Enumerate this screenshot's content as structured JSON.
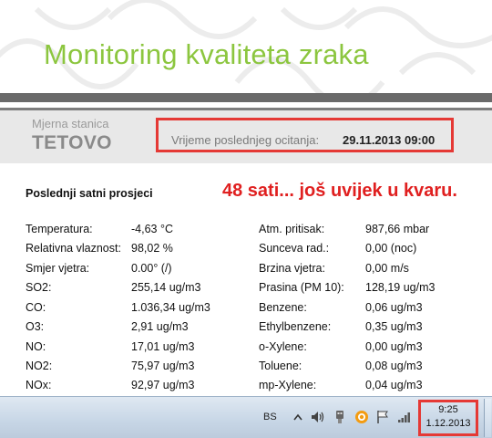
{
  "header": {
    "title": "Monitoring kvaliteta zraka"
  },
  "station": {
    "label": "Mjerna stanica",
    "name": "TETOVO",
    "reading_label": "Vrijeme poslednjeg ocitanja:",
    "reading_value": "29.11.2013 09:00"
  },
  "main": {
    "section_title": "Poslednji satni prosjeci",
    "alert": "48 sati... još uvijek u kvaru.",
    "left_measurements": [
      {
        "label": "Temperatura:",
        "value": "-4,63 °C"
      },
      {
        "label": "Relativna vlaznost:",
        "value": "98,02 %"
      },
      {
        "label": "Smjer vjetra:",
        "value": "0.00° (/)"
      },
      {
        "label": "SO2:",
        "value": "255,14 ug/m3"
      },
      {
        "label": "CO:",
        "value": "1.036,34 ug/m3"
      },
      {
        "label": "O3:",
        "value": "2,91 ug/m3"
      },
      {
        "label": "NO:",
        "value": "17,01 ug/m3"
      },
      {
        "label": "NO2:",
        "value": "75,97 ug/m3"
      },
      {
        "label": "NOx:",
        "value": "92,97 ug/m3"
      }
    ],
    "right_measurements": [
      {
        "label": "Atm. pritisak:",
        "value": "987,66 mbar"
      },
      {
        "label": "Sunceva rad.:",
        "value": "0,00 (noc)"
      },
      {
        "label": "Brzina vjetra:",
        "value": "0,00 m/s"
      },
      {
        "label": "Prasina (PM 10):",
        "value": "128,19 ug/m3"
      },
      {
        "label": "Benzene:",
        "value": "0,06 ug/m3"
      },
      {
        "label": "Ethylbenzene:",
        "value": "0,35 ug/m3"
      },
      {
        "label": "o-Xylene:",
        "value": "0,00 ug/m3"
      },
      {
        "label": "Toluene:",
        "value": "0,08 ug/m3"
      },
      {
        "label": "mp-Xylene:",
        "value": "0,04 ug/m3"
      }
    ]
  },
  "taskbar": {
    "language": "BS",
    "time": "9:25",
    "date": "1.12.2013",
    "tray_icons": [
      "chevron-up-icon",
      "speaker-icon",
      "usb-device-icon",
      "antivirus-icon",
      "flag-icon",
      "network-signal-icon"
    ]
  },
  "colors": {
    "title_green": "#8cc63f",
    "alert_red": "#e02020",
    "highlight_red": "#e53935"
  }
}
